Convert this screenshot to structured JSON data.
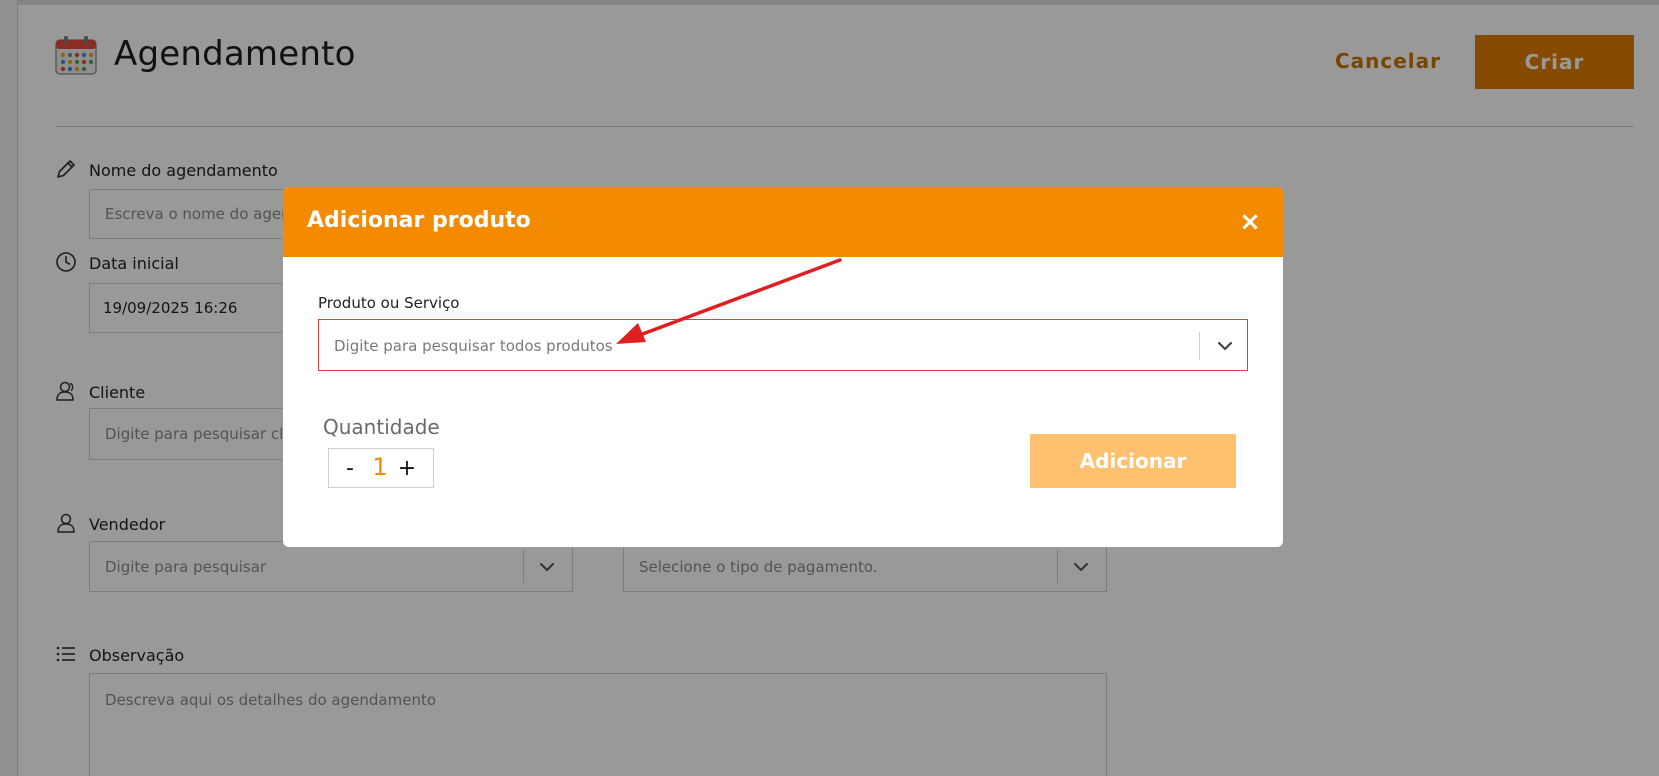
{
  "page": {
    "title": "Agendamento",
    "cancel_label": "Cancelar",
    "create_label": "Criar"
  },
  "form": {
    "name": {
      "label": "Nome do agendamento",
      "placeholder": "Escreva o nome do agendamento"
    },
    "start_date": {
      "label": "Data inicial",
      "value": "19/09/2025 16:26"
    },
    "client": {
      "label": "Cliente",
      "placeholder": "Digite para pesquisar clientes"
    },
    "seller": {
      "label": "Vendedor",
      "placeholder": "Digite para pesquisar"
    },
    "payment": {
      "placeholder": "Selecione o tipo de pagamento."
    },
    "notes": {
      "label": "Observação",
      "placeholder": "Descreva aqui os detalhes do agendamento"
    }
  },
  "modal": {
    "title": "Adicionar produto",
    "close_symbol": "×",
    "product_label": "Produto ou Serviço",
    "product_placeholder": "Digite para pesquisar todos produtos",
    "quantity_label": "Quantidade",
    "quantity_value": "1",
    "minus_symbol": "-",
    "plus_symbol": "+",
    "add_label": "Adicionar"
  },
  "icons": {
    "calendar": "calendar-icon",
    "pencil": "pencil-icon",
    "clock": "clock-icon",
    "client": "users-icon",
    "seller": "user-icon",
    "notes": "list-icon",
    "chevron": "chevron-down-icon",
    "close": "close-icon"
  },
  "colors": {
    "accent": "#f38a00",
    "button_dark": "#e07e00",
    "add_button_disabled": "#ffc170",
    "error_border": "#e23a48",
    "annotation_arrow": "#e02020"
  }
}
